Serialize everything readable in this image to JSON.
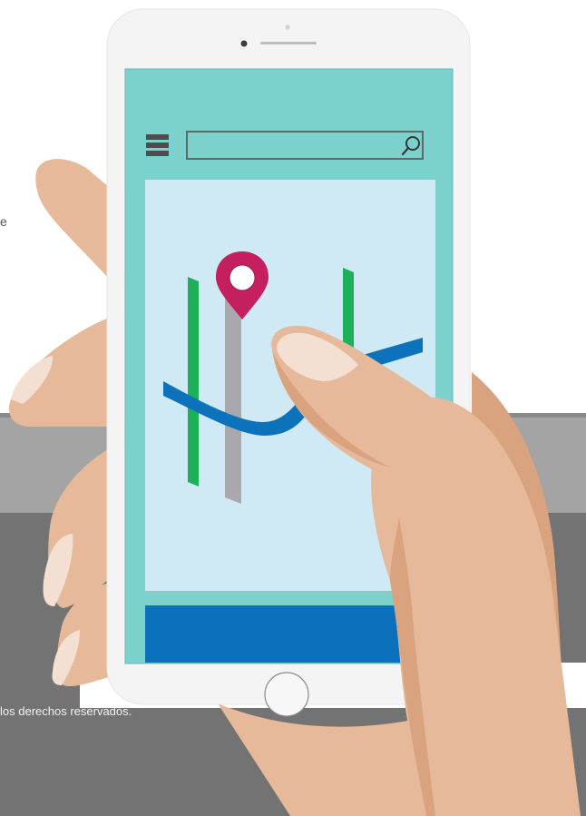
{
  "app": {
    "footer_text": "los derechos reservados.",
    "stray_letter": "e"
  },
  "search": {
    "placeholder": "",
    "value": "",
    "icon": "search-icon"
  },
  "menu": {
    "icon": "hamburger-menu-icon"
  },
  "map": {
    "pin_icon": "map-pin-icon",
    "lines": [
      "green-line",
      "gray-line",
      "green-line",
      "blue-line"
    ]
  },
  "colors": {
    "screen_bg": "#7dd1cc",
    "map_bg": "#cfeaf4",
    "pin": "#c41f5f",
    "blue_route": "#0c72bc",
    "green_route": "#1cb158",
    "gray_route": "#a9a9ad",
    "skin": "#e6b99b",
    "skin_shadow": "#d9a37f",
    "bottom_panel": "#0b70bb",
    "phone_body": "#f4f4f4"
  }
}
